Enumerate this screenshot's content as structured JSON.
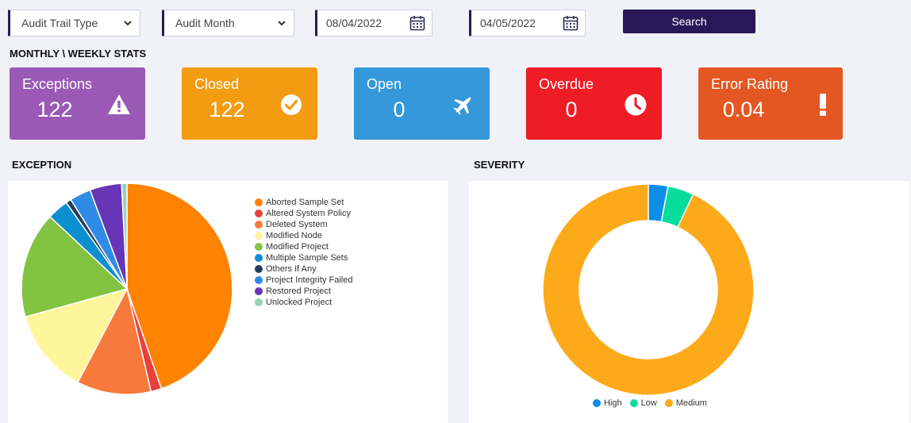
{
  "filters": {
    "audit_trail_type": "Audit Trail Type",
    "audit_month": "Audit Month",
    "from_date": "08/04/2022",
    "to_date": "04/05/2022",
    "search_label": "Search"
  },
  "stats_title": "MONTHLY \\ WEEKLY STATS",
  "cards": [
    {
      "label": "Exceptions",
      "value": "122",
      "color": "#9b59b6",
      "icon": "warning-icon"
    },
    {
      "label": "Closed",
      "value": "122",
      "color": "#f39c12",
      "icon": "check-circle-icon"
    },
    {
      "label": "Open",
      "value": "0",
      "color": "#3498db",
      "icon": "plane-icon"
    },
    {
      "label": "Overdue",
      "value": "0",
      "color": "#ee1c25",
      "icon": "clock-icon"
    },
    {
      "label": "Error Rating",
      "value": "0.04",
      "color": "#e55722",
      "icon": "exclamation-icon"
    }
  ],
  "exception_title": "EXCEPTION",
  "severity_title": "SEVERITY",
  "chart_data": [
    {
      "type": "pie",
      "categories": [
        "Aborted Sample Set",
        "Altered System Policy",
        "Deleted System",
        "Modified Node",
        "Modified Project",
        "Multiple Sample Sets",
        "Others If Any",
        "Project Integrity Failed",
        "Restored Project",
        "Unlocked Project"
      ],
      "values": [
        55,
        2,
        14,
        16,
        20,
        4,
        1,
        4,
        6,
        1
      ],
      "colors": [
        "#ff8200",
        "#e8403a",
        "#f7793c",
        "#fff59a",
        "#82c341",
        "#0c8fcf",
        "#273a5a",
        "#2e8ce6",
        "#6636b7",
        "#97d2b8"
      ],
      "legend": "right"
    },
    {
      "type": "pie",
      "categories": [
        "High",
        "Low",
        "Medium"
      ],
      "values": [
        3,
        4,
        93
      ],
      "colors": [
        "#0b8de8",
        "#08dc9c",
        "#fdaa1a"
      ],
      "legend": "bottom"
    }
  ]
}
